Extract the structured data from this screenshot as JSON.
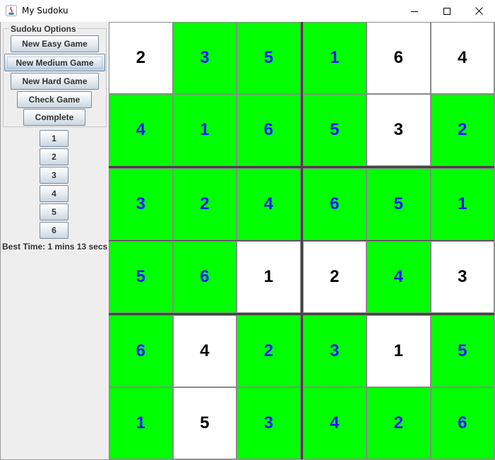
{
  "window": {
    "title": "My Sudoku",
    "minimize_icon": "minimize-icon",
    "maximize_icon": "maximize-icon",
    "close_icon": "close-icon"
  },
  "options": {
    "legend": "Sudoku Options",
    "buttons": [
      "New Easy Game",
      "New Medium Game",
      "New Hard Game",
      "Check Game",
      "Complete"
    ]
  },
  "number_buttons": [
    "1",
    "2",
    "3",
    "4",
    "5",
    "6"
  ],
  "best_time": "Best Time: 1 mins 13 secs",
  "colors": {
    "given_bg": "#ffffff",
    "entered_bg": "#00ff00",
    "given_text": "#000000",
    "entered_text": "#1a1aff"
  },
  "board": {
    "rows": [
      [
        {
          "v": "2",
          "t": "given"
        },
        {
          "v": "3",
          "t": "entered"
        },
        {
          "v": "5",
          "t": "entered"
        },
        {
          "v": "1",
          "t": "entered"
        },
        {
          "v": "6",
          "t": "given"
        },
        {
          "v": "4",
          "t": "given"
        }
      ],
      [
        {
          "v": "4",
          "t": "entered"
        },
        {
          "v": "1",
          "t": "entered"
        },
        {
          "v": "6",
          "t": "entered"
        },
        {
          "v": "5",
          "t": "entered"
        },
        {
          "v": "3",
          "t": "given"
        },
        {
          "v": "2",
          "t": "entered"
        }
      ],
      [
        {
          "v": "3",
          "t": "entered"
        },
        {
          "v": "2",
          "t": "entered"
        },
        {
          "v": "4",
          "t": "entered"
        },
        {
          "v": "6",
          "t": "entered"
        },
        {
          "v": "5",
          "t": "entered"
        },
        {
          "v": "1",
          "t": "entered"
        }
      ],
      [
        {
          "v": "5",
          "t": "entered"
        },
        {
          "v": "6",
          "t": "entered"
        },
        {
          "v": "1",
          "t": "given"
        },
        {
          "v": "2",
          "t": "given"
        },
        {
          "v": "4",
          "t": "entered"
        },
        {
          "v": "3",
          "t": "given"
        }
      ],
      [
        {
          "v": "6",
          "t": "entered"
        },
        {
          "v": "4",
          "t": "given"
        },
        {
          "v": "2",
          "t": "entered"
        },
        {
          "v": "3",
          "t": "entered"
        },
        {
          "v": "1",
          "t": "given"
        },
        {
          "v": "5",
          "t": "entered"
        }
      ],
      [
        {
          "v": "1",
          "t": "entered"
        },
        {
          "v": "5",
          "t": "given"
        },
        {
          "v": "3",
          "t": "entered"
        },
        {
          "v": "4",
          "t": "entered"
        },
        {
          "v": "2",
          "t": "entered"
        },
        {
          "v": "6",
          "t": "entered"
        }
      ]
    ]
  }
}
